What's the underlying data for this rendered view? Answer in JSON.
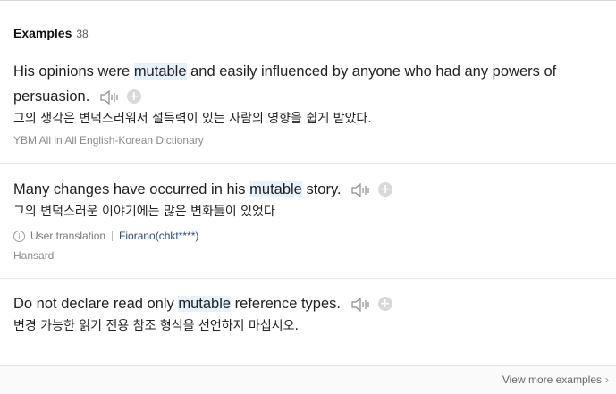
{
  "header": {
    "title": "Examples",
    "count": "38"
  },
  "examples": [
    {
      "pre": "His opinions were ",
      "keyword": "mutable",
      "post": " and easily influenced by anyone who had any powers of persuasion.",
      "translation": "그의 생각은 변덕스러워서 설득력이 있는 사람의 영향을 쉽게 받았다.",
      "source": "YBM All in All English-Korean Dictionary"
    },
    {
      "pre": "Many changes have occurred in his ",
      "keyword": "mutable",
      "post": " story.",
      "translation": "그의 변덕스러운 이야기에는 많은 변화들이 있었다",
      "user_translation_label": "User translation",
      "user_name": "Fiorano(chkt****)",
      "source": "Hansard"
    },
    {
      "pre": "Do not declare read only ",
      "keyword": "mutable",
      "post": " reference types.",
      "translation": "변경 가능한 읽기 전용 참조 형식을 선언하지 마십시오."
    }
  ],
  "footer": {
    "more_label": "View more examples"
  },
  "icons": {
    "speaker": "speaker-icon",
    "add": "plus-circle-icon",
    "info": "info-icon",
    "chevron": "chevron-right-icon"
  },
  "colors": {
    "highlight": "#e6f1fb",
    "user_link": "#2d4a7a"
  }
}
